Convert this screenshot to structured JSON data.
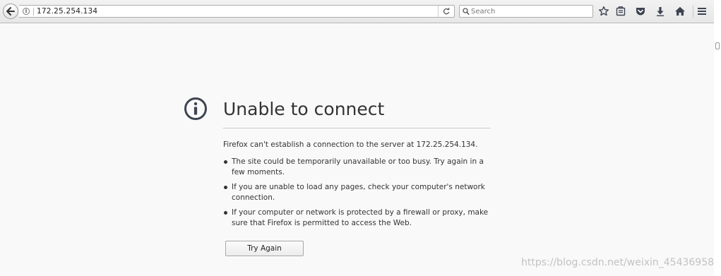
{
  "toolbar": {
    "url": "172.25.254.134",
    "search_placeholder": "Search",
    "icons": [
      "back-arrow-icon",
      "info-icon",
      "reload-icon",
      "search-icon",
      "bookmark-star-icon",
      "reading-list-icon",
      "pocket-icon",
      "download-icon",
      "home-icon",
      "hamburger-menu-icon"
    ]
  },
  "error": {
    "title": "Unable to connect",
    "description": "Firefox can't establish a connection to the server at 172.25.254.134.",
    "items": [
      "The site could be temporarily unavailable or too busy. Try again in a few moments.",
      "If you are unable to load any pages, check your computer's network connection.",
      "If your computer or network is protected by a firewall or proxy, make sure that Firefox is permitted to access the Web."
    ],
    "button_label": "Try Again"
  },
  "watermark": "https://blog.csdn.net/weixin_45436958",
  "colors": {
    "page_bg": "#f9f9fa",
    "text": "#333333",
    "icon": "#3d4451"
  }
}
